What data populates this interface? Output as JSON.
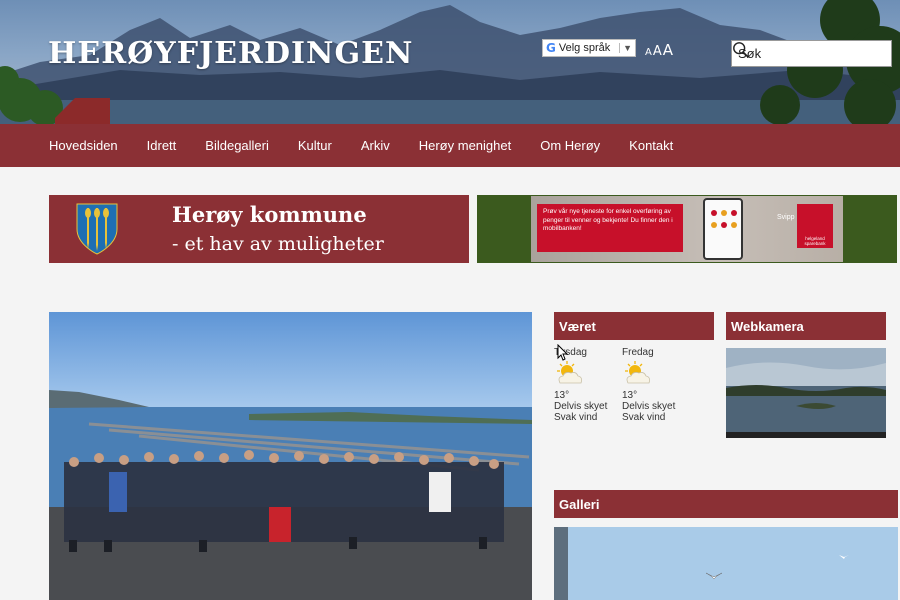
{
  "header": {
    "site_title": "HERØYFJERDINGEN",
    "translate_label": "Velg språk",
    "translate_caret": "▼",
    "font_sizes": [
      "A",
      "A",
      "A"
    ],
    "search_placeholder": "Søk"
  },
  "nav": {
    "items": [
      "Hovedsiden",
      "Idrett",
      "Bildegalleri",
      "Kultur",
      "Arkiv",
      "Herøy menighet",
      "Om Herøy",
      "Kontakt"
    ]
  },
  "banners": {
    "kommune_title": "Herøy kommune",
    "kommune_subtitle": "- et hav av muligheter",
    "ad_text": "Prøv vår nye tjeneste for enkel overføring av penger til venner og bekjente! Du finner den i mobilbanken!",
    "ad_vipps": "Svipp Kæsj",
    "ad_bank": "helgeland sparebank"
  },
  "weather": {
    "title": "Været",
    "days": [
      {
        "day": "Tirsdag",
        "temp": "13°",
        "sky": "Delvis skyet",
        "wind": "Svak vind"
      },
      {
        "day": "Fredag",
        "temp": "13°",
        "sky": "Delvis skyet",
        "wind": "Svak vind"
      }
    ]
  },
  "webcam": {
    "title": "Webkamera"
  },
  "gallery": {
    "title": "Galleri"
  },
  "colors": {
    "brand": "#8b3035",
    "ad_green": "#3b5a1e",
    "ad_red": "#c7102a"
  }
}
